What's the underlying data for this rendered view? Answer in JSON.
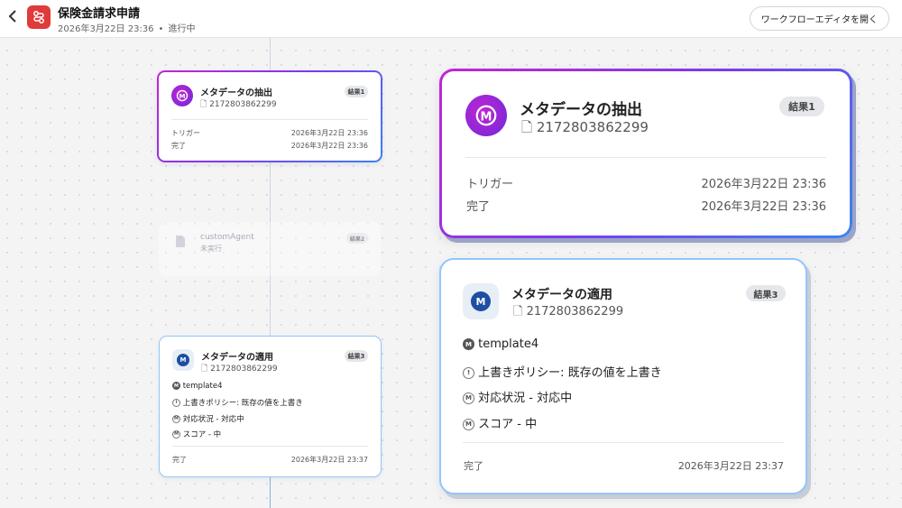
{
  "header": {
    "back_icon": "chevron-left-icon",
    "app_icon": "workflow-icon",
    "title": "保険金請求申請",
    "date": "2026年3月22日 23:36",
    "separator": "•",
    "status": "進行中",
    "open_editor_label": "ワークフローエディタを開く"
  },
  "timeline": {
    "extract": {
      "title": "メタデータの抽出",
      "file_id": "2172803862299",
      "badge": "結果1",
      "rows": [
        {
          "label": "トリガー",
          "value": "2026年3月22日 23:36"
        },
        {
          "label": "完了",
          "value": "2026年3月22日 23:36"
        }
      ]
    },
    "agent": {
      "title": "customAgent",
      "status": "未実行",
      "badge": "結果2"
    },
    "apply": {
      "title": "メタデータの適用",
      "file_id": "2172803862299",
      "badge": "結果3",
      "items": [
        {
          "icon": "metadata-icon",
          "text": "template4"
        },
        {
          "icon": "clock-icon",
          "text": "上書きポリシー: 既存の値を上書き"
        },
        {
          "icon": "metadata-icon",
          "text": "対応状況 - 対応中"
        },
        {
          "icon": "metadata-icon",
          "text": "スコア - 中"
        }
      ],
      "rows": [
        {
          "label": "完了",
          "value": "2026年3月22日 23:37"
        }
      ]
    }
  },
  "colors": {
    "accent_red": "#e03a3a",
    "purple_gradient_start": "#c026d3",
    "purple_gradient_end": "#3b82f6",
    "blue_border": "#93c5fd",
    "blue_icon": "#1d4fa3"
  }
}
